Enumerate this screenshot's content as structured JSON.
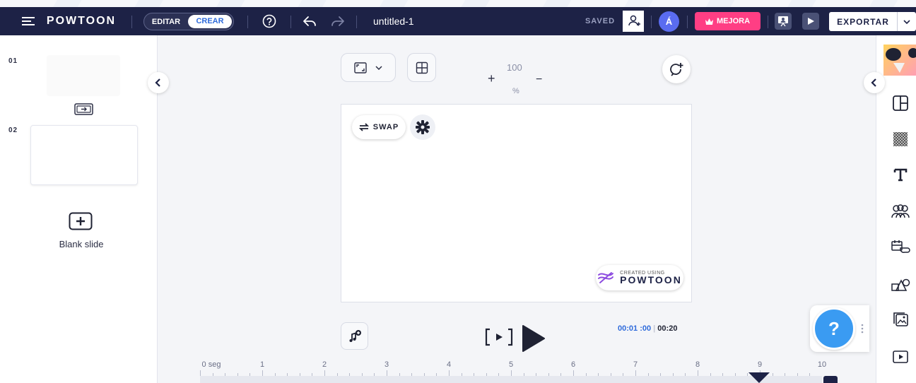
{
  "topbar": {
    "brand": "POWTOON",
    "mode_edit": "EDITAR",
    "mode_create": "CREAR",
    "project_title": "untitled-1",
    "saved_status": "SAVED",
    "user_initial": "Á",
    "upgrade_label": "MEJORA",
    "export_label": "EXPORTAR",
    "colors": {
      "bar": "#1d2246",
      "upgrade": "#ff3e84",
      "avatar": "#5a6cf0",
      "accent": "#2f6bdb"
    }
  },
  "slides": [
    {
      "number": "01"
    },
    {
      "number": "02"
    }
  ],
  "left_panel": {
    "blank_slide_label": "Blank slide"
  },
  "canvas": {
    "zoom_value": "100",
    "zoom_unit": "%",
    "zoom_plus": "+",
    "zoom_minus": "−",
    "swap_label": "SWAP",
    "badge_small": "CREATED USING",
    "badge_brand": "POWTOON"
  },
  "player": {
    "current_time": "00:01 :00",
    "separator": "|",
    "total_time": "00:20"
  },
  "timeline": {
    "labels": [
      "0 seg",
      "1",
      "2",
      "3",
      "4",
      "5",
      "6",
      "7",
      "8",
      "9",
      "10"
    ],
    "playhead_seconds": 9
  },
  "help": {
    "label": "?"
  },
  "right_panel": {
    "icons": [
      "layout-icon",
      "background-icon",
      "text-icon",
      "characters-icon",
      "props-icon",
      "shapes-icon",
      "media-icon",
      "video-icon"
    ]
  }
}
